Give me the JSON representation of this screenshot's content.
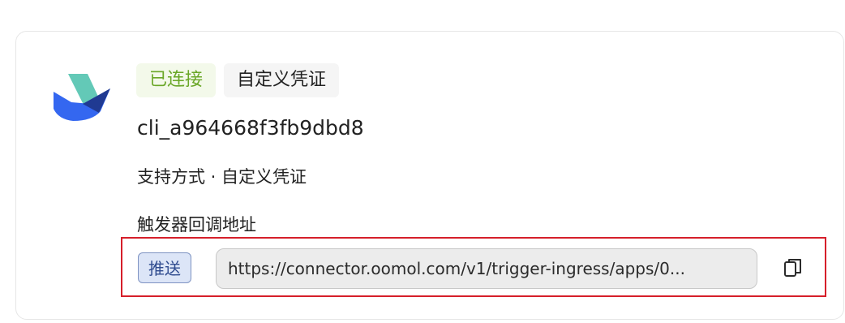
{
  "card": {
    "logo_icon": "blue-green-bird-logo-icon",
    "status_badge": "已连接",
    "credential_badge": "自定义凭证",
    "client_id": "cli_a964668f3fb9dbd8",
    "support_line": "支持方式 · 自定义凭证",
    "trigger_section_title": "触发器回调地址",
    "push_tag": "推送",
    "callback_url": "https://connector.oomol.com/v1/trigger-ingress/apps/0...",
    "copy_icon": "copy-icon"
  },
  "colors": {
    "connected_text": "#6aa728",
    "connected_bg": "#f3f9ea",
    "highlight_border": "#d61f2a",
    "push_tag_text": "#2f4b8f",
    "push_tag_bg": "#dce5f7"
  }
}
